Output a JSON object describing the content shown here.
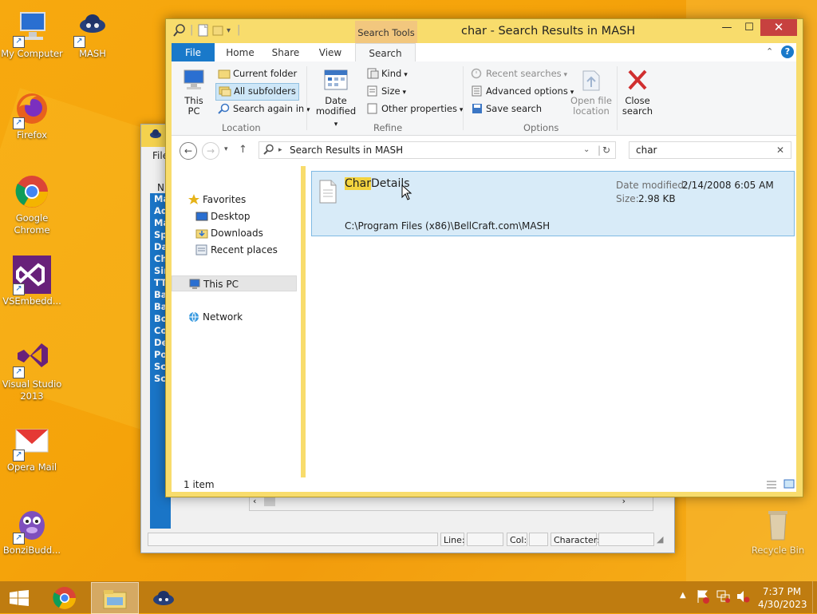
{
  "desktop": {
    "icons": [
      {
        "label": "My Computer"
      },
      {
        "label": "MASH"
      },
      {
        "label": "Firefox"
      },
      {
        "label": "Google Chrome"
      },
      {
        "label": "VSEmbedd..."
      },
      {
        "label": "Visual Studio 2013"
      },
      {
        "label": "Opera Mail"
      },
      {
        "label": "BonziBudd..."
      },
      {
        "label": "Recycle Bin"
      }
    ]
  },
  "mash_window": {
    "menu_partial": "File",
    "left_partial": "N",
    "list_items": [
      "Ma",
      "Ad",
      "Ma",
      "Sp",
      "Da",
      "Ch",
      "Sin",
      "TT",
      "Ba",
      "Ba",
      "Bo",
      "Co",
      "De",
      "Po",
      "Sc",
      "Sc"
    ],
    "status": {
      "line_label": "Line:",
      "col_label": "Col:",
      "character_label": "Character:"
    }
  },
  "explorer": {
    "title": "char - Search Results in MASH",
    "context_tab": "Search Tools",
    "tabs": {
      "file": "File",
      "home": "Home",
      "share": "Share",
      "view": "View",
      "search": "Search"
    },
    "ribbon": {
      "this_pc": "This PC",
      "current_folder": "Current folder",
      "all_subfolders": "All subfolders",
      "search_again_in": "Search again in",
      "location_group": "Location",
      "date_modified": "Date modified",
      "kind": "Kind",
      "size": "Size",
      "other_properties": "Other properties",
      "refine_group": "Refine",
      "recent_searches": "Recent searches",
      "advanced_options": "Advanced options",
      "save_search": "Save search",
      "options_group": "Options",
      "open_file_location": "Open file location",
      "close_search": "Close search"
    },
    "address": {
      "path": "Search Results in MASH"
    },
    "search": {
      "value": "char"
    },
    "nav": {
      "favorites": "Favorites",
      "desktop": "Desktop",
      "downloads": "Downloads",
      "recent_places": "Recent places",
      "this_pc": "This PC",
      "network": "Network"
    },
    "result": {
      "name_highlight": "Char",
      "name_rest": "Details",
      "date_label": "Date modified:",
      "date_value": "2/14/2008 6:05 AM",
      "size_label": "Size:",
      "size_value": "2.98 KB",
      "path": "C:\\Program Files (x86)\\BellCraft.com\\MASH"
    },
    "status_count": "1 item"
  },
  "taskbar": {
    "time": "7:37 PM",
    "date": "4/30/2023"
  }
}
